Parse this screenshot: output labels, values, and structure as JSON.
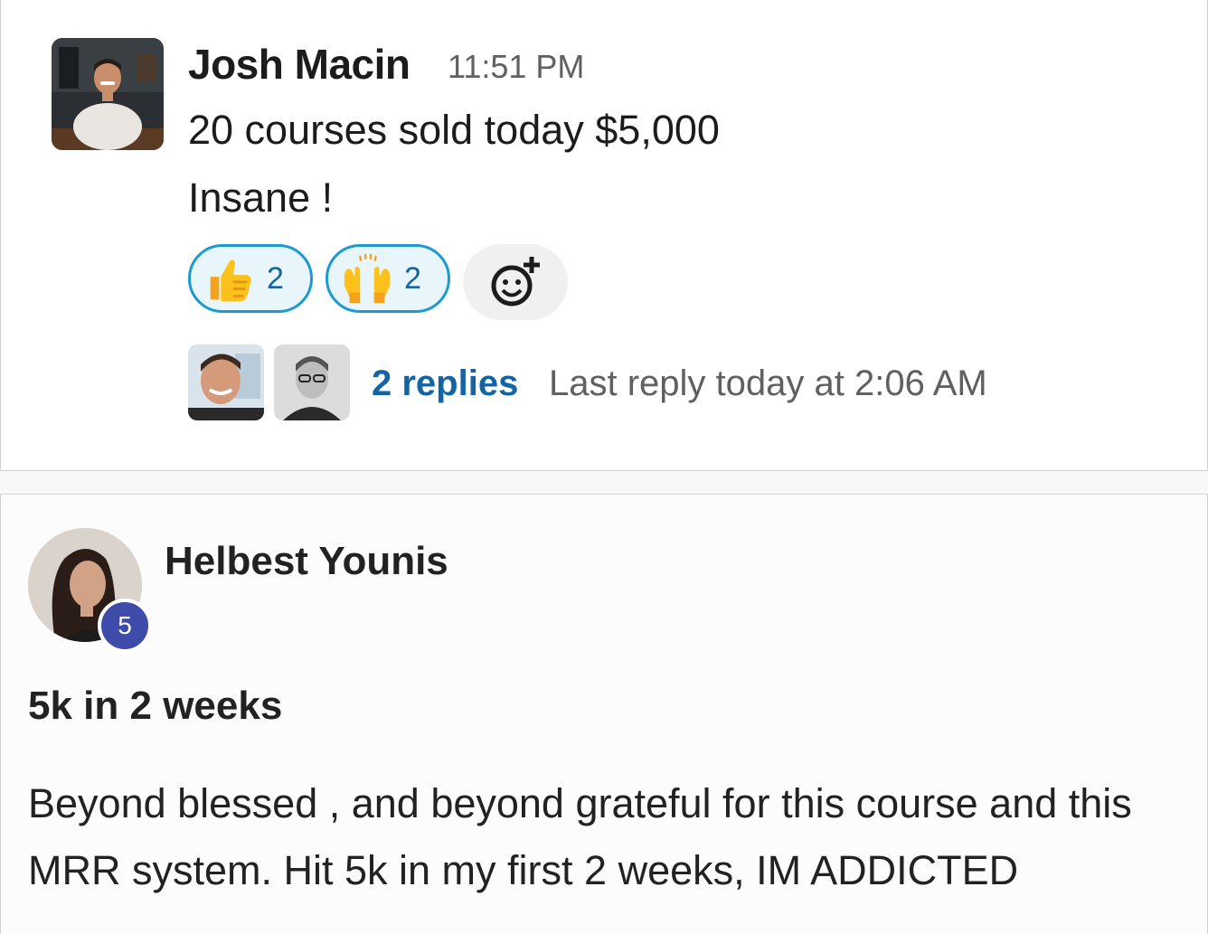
{
  "message": {
    "author": "Josh Macin",
    "time": "11:51 PM",
    "lines": [
      "20 courses sold today $5,000",
      "Insane !"
    ],
    "reactions": [
      {
        "emoji": "thumbs-up-icon",
        "count": "2"
      },
      {
        "emoji": "raised-hands-icon",
        "count": "2"
      }
    ],
    "add_reaction_icon": "add-reaction-icon",
    "thread": {
      "replies": "2 replies",
      "last_reply": "Last reply today at 2:06 AM"
    }
  },
  "post": {
    "author": "Helbest Younis",
    "level": "5",
    "title": "5k in 2 weeks",
    "body": "Beyond blessed , and beyond grateful for this course and this MRR system. Hit 5k in my first 2 weeks, IM ADDICTED"
  },
  "colors": {
    "link": "#1264a3",
    "reaction_border": "#1d9bd1",
    "reaction_bg": "#e8f5fa",
    "badge": "#3e4ba8"
  }
}
